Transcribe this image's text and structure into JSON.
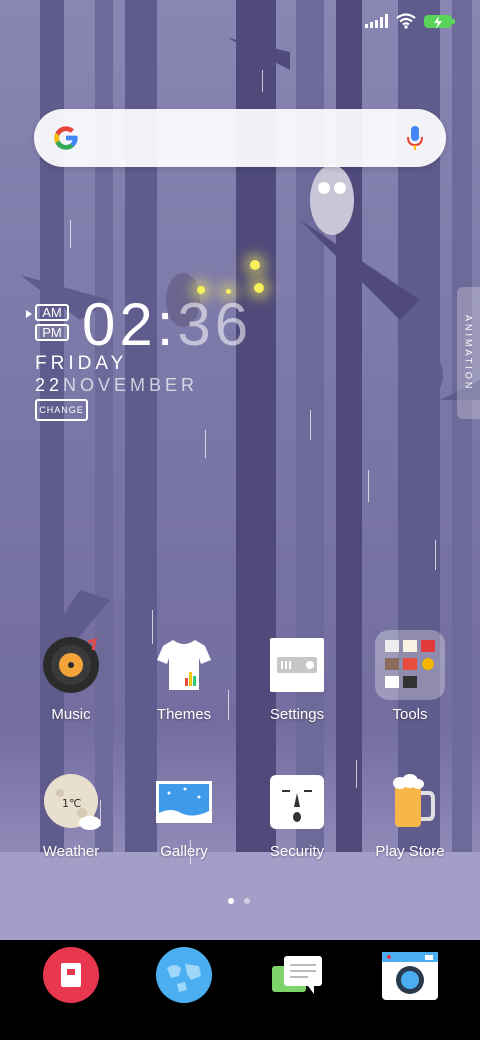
{
  "status_bar": {
    "signal_icon": "signal-icon",
    "wifi_icon": "wifi-icon",
    "battery_icon": "battery-charging-icon",
    "battery_color": "#5ad35a"
  },
  "search": {
    "placeholder": "",
    "google_icon": "google-logo-icon",
    "mic_icon": "mic-icon"
  },
  "clock_widget": {
    "am": "AM",
    "pm": "PM",
    "hours": "02",
    "separator": ":",
    "minutes": "36",
    "day": "FRIDAY",
    "date_day": "22",
    "month": "NOVEMBER",
    "change_label": "CHANGE"
  },
  "side_tab": {
    "label": "ANIMATION"
  },
  "apps": [
    {
      "label": "Music",
      "icon": "vinyl-record-icon"
    },
    {
      "label": "Themes",
      "icon": "tshirt-icon"
    },
    {
      "label": "Settings",
      "icon": "settings-switch-icon"
    },
    {
      "label": "Tools",
      "icon": "folder-icon"
    },
    {
      "label": "Weather",
      "icon": "moon-weather-icon",
      "temp": "1℃"
    },
    {
      "label": "Gallery",
      "icon": "gallery-picture-icon"
    },
    {
      "label": "Security",
      "icon": "security-face-icon"
    },
    {
      "label": "Play Store",
      "icon": "beer-mug-icon"
    }
  ],
  "page_indicator": {
    "pages": 2,
    "current": 1
  },
  "dock": [
    {
      "icon": "phone-icon"
    },
    {
      "icon": "browser-globe-icon"
    },
    {
      "icon": "messages-icon"
    },
    {
      "icon": "camera-icon"
    }
  ],
  "colors": {
    "wallpaper": "#7a76a6",
    "dock": "#000000",
    "accent_green": "#5ad35a"
  }
}
